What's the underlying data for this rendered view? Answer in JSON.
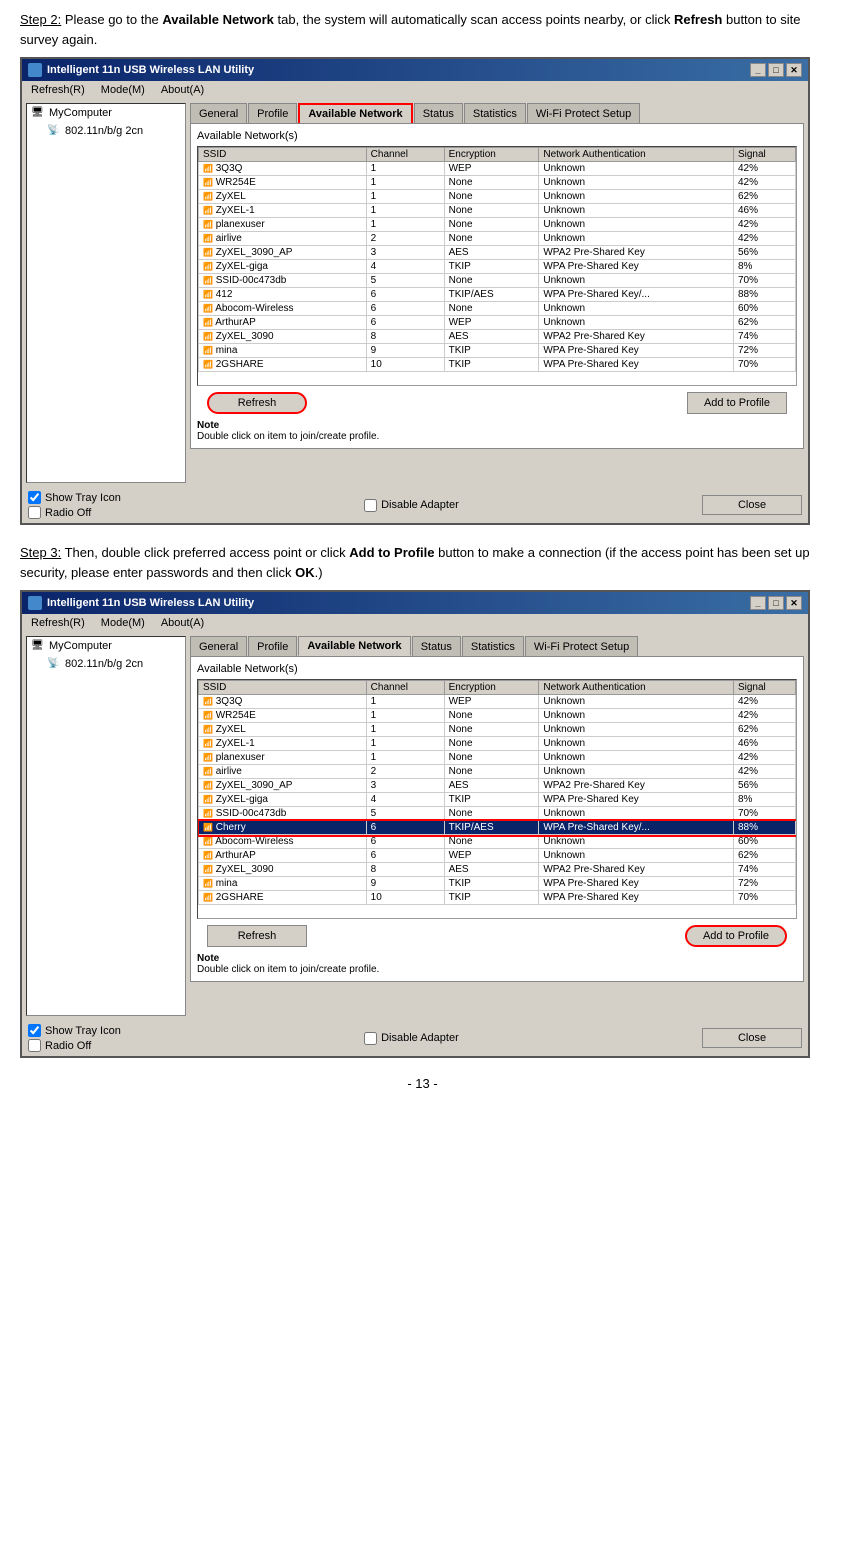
{
  "step2": {
    "heading": "Step 2:",
    "description": "Please go to the ",
    "bold1": "Available Network",
    "description2": " tab, the system will automatically scan access points nearby, or click ",
    "bold2": "Refresh",
    "description3": " button to site survey again."
  },
  "step3": {
    "heading": "Step 3:",
    "description": "Then, double click preferred access point or click ",
    "bold1": "Add to Profile",
    "description2": " button to make a connection (if the access point has been set up security, please enter passwords and then click ",
    "bold2": "OK",
    "description3": ".)"
  },
  "window": {
    "title": "Intelligent 11n USB Wireless LAN Utility",
    "menu": [
      "Refresh(R)",
      "Mode(M)",
      "About(A)"
    ],
    "sidebar": {
      "computer": "MyComputer",
      "adapter": "802.11n/b/g 2cn"
    },
    "tabs": [
      "General",
      "Profile",
      "Available Network",
      "Status",
      "Statistics",
      "Wi-Fi Protect Setup"
    ],
    "active_tab": "Available Network",
    "content_title": "Available Network(s)",
    "table": {
      "headers": [
        "SSID",
        "Channel",
        "Encryption",
        "Network Authentication",
        "Signal"
      ],
      "rows": [
        [
          "3Q3Q",
          "1",
          "WEP",
          "Unknown",
          "42%"
        ],
        [
          "WR254E",
          "1",
          "None",
          "Unknown",
          "42%"
        ],
        [
          "ZyXEL",
          "1",
          "None",
          "Unknown",
          "62%"
        ],
        [
          "ZyXEL-1",
          "1",
          "None",
          "Unknown",
          "46%"
        ],
        [
          "planexuser",
          "1",
          "None",
          "Unknown",
          "42%"
        ],
        [
          "airlive",
          "2",
          "None",
          "Unknown",
          "42%"
        ],
        [
          "ZyXEL_3090_AP",
          "3",
          "AES",
          "WPA2 Pre-Shared Key",
          "56%"
        ],
        [
          "ZyXEL-giga",
          "4",
          "TKIP",
          "WPA Pre-Shared Key",
          "8%"
        ],
        [
          "SSID-00c473db",
          "5",
          "None",
          "Unknown",
          "70%"
        ],
        [
          "412",
          "6",
          "TKIP/AES",
          "WPA Pre-Shared Key/...",
          "88%"
        ],
        [
          "Abocom-Wireless",
          "6",
          "None",
          "Unknown",
          "60%"
        ],
        [
          "ArthurAP",
          "6",
          "WEP",
          "Unknown",
          "62%"
        ],
        [
          "ZyXEL_3090",
          "8",
          "AES",
          "WPA2 Pre-Shared Key",
          "74%"
        ],
        [
          "mina",
          "9",
          "TKIP",
          "WPA Pre-Shared Key",
          "72%"
        ],
        [
          "2GSHARE",
          "10",
          "TKIP",
          "WPA Pre-Shared Key",
          "70%"
        ]
      ]
    },
    "refresh_btn": "Refresh",
    "add_profile_btn": "Add to Profile",
    "note": "Note",
    "note_text": "Double click on item to join/create profile.",
    "show_tray": "Show Tray Icon",
    "disable_adapter": "Disable Adapter",
    "radio_off": "Radio Off",
    "close_btn": "Close"
  },
  "window2": {
    "title": "Intelligent 11n USB Wireless LAN Utility",
    "menu": [
      "Refresh(R)",
      "Mode(M)",
      "About(A)"
    ],
    "sidebar": {
      "computer": "MyComputer",
      "adapter": "802.11n/b/g 2cn"
    },
    "tabs": [
      "General",
      "Profile",
      "Available Network",
      "Status",
      "Statistics",
      "Wi-Fi Protect Setup"
    ],
    "active_tab": "Available Network",
    "content_title": "Available Network(s)",
    "table": {
      "headers": [
        "SSID",
        "Channel",
        "Encryption",
        "Network Authentication",
        "Signal"
      ],
      "rows": [
        [
          "3Q3Q",
          "1",
          "WEP",
          "Unknown",
          "42%"
        ],
        [
          "WR254E",
          "1",
          "None",
          "Unknown",
          "42%"
        ],
        [
          "ZyXEL",
          "1",
          "None",
          "Unknown",
          "62%"
        ],
        [
          "ZyXEL-1",
          "1",
          "None",
          "Unknown",
          "46%"
        ],
        [
          "planexuser",
          "1",
          "None",
          "Unknown",
          "42%"
        ],
        [
          "airlive",
          "2",
          "None",
          "Unknown",
          "42%"
        ],
        [
          "ZyXEL_3090_AP",
          "3",
          "AES",
          "WPA2 Pre-Shared Key",
          "56%"
        ],
        [
          "ZyXEL-giga",
          "4",
          "TKIP",
          "WPA Pre-Shared Key",
          "8%"
        ],
        [
          "SSID-00c473db",
          "5",
          "None",
          "Unknown",
          "70%"
        ],
        [
          "Cherry",
          "6",
          "TKIP/AES",
          "WPA Pre-Shared Key/...",
          "88%"
        ],
        [
          "Abocom-Wireless",
          "6",
          "None",
          "Unknown",
          "60%"
        ],
        [
          "ArthurAP",
          "6",
          "WEP",
          "Unknown",
          "62%"
        ],
        [
          "ZyXEL_3090",
          "8",
          "AES",
          "WPA2 Pre-Shared Key",
          "74%"
        ],
        [
          "mina",
          "9",
          "TKIP",
          "WPA Pre-Shared Key",
          "72%"
        ],
        [
          "2GSHARE",
          "10",
          "TKIP",
          "WPA Pre-Shared Key",
          "70%"
        ]
      ],
      "selected_row": 9
    },
    "refresh_btn": "Refresh",
    "add_profile_btn": "Add to Profile",
    "note": "Note",
    "note_text": "Double click on item to join/create profile.",
    "show_tray": "Show Tray Icon",
    "disable_adapter": "Disable Adapter",
    "radio_off": "Radio Off",
    "close_btn": "Close"
  },
  "page_number": "- 13 -",
  "colors": {
    "titlebar_start": "#0a246a",
    "titlebar_end": "#3a6ea5",
    "selected_row": "#0a246a"
  }
}
